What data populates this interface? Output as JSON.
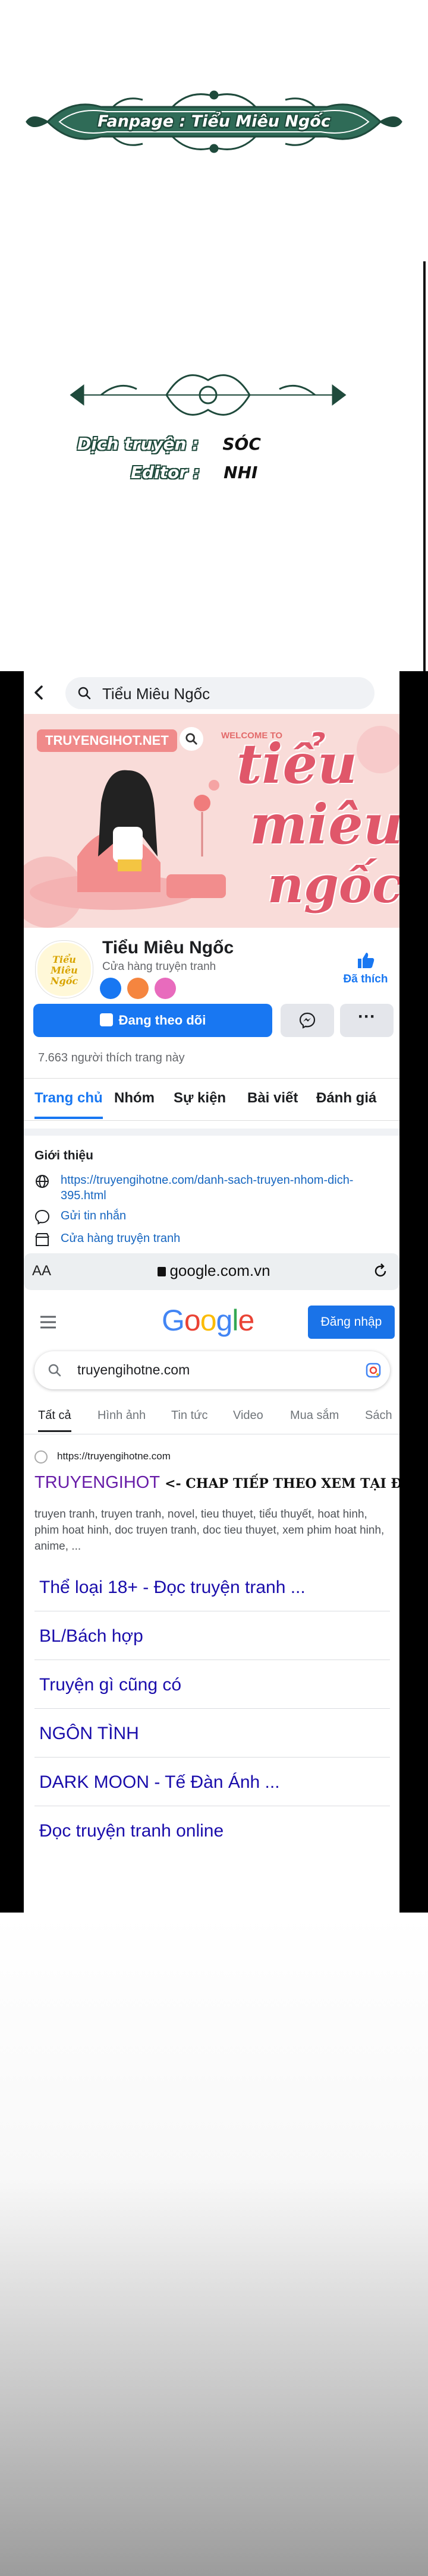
{
  "credits": {
    "fanpage": "Fanpage : Tiểu Miêu Ngốc",
    "translator_label": "Dịch truyện :",
    "translator": "SÓC",
    "editor_label": "Editor :",
    "editor": "NHI"
  },
  "facebook": {
    "search_text": "Tiểu Miêu Ngốc",
    "cover": {
      "logo": "TRUYENGIHOT.NET",
      "welcome": "WELCOME TO",
      "script_lines": [
        "tiểu",
        "miêu",
        "ngốc"
      ]
    },
    "page_name": "Tiểu Miêu Ngốc",
    "category": "Cửa hàng truyện tranh",
    "followed_label": "Đã thích",
    "follow_button": "Đang theo dõi",
    "more_button": "···",
    "likes_text": "7.663 người thích trang này",
    "tabs": [
      "Trang chủ",
      "Nhóm",
      "Sự kiện",
      "Bài viết",
      "Đánh giá"
    ],
    "about": {
      "title": "Giới thiệu",
      "website": "https://truyengihotne.com/danh-sach-truyen-nhom-dich-395.html",
      "message": "Gửi tin nhắn",
      "category": "Cửa hàng truyện tranh"
    },
    "avatar_text": "Tiểu Miêu Ngốc"
  },
  "browser": {
    "aa": "AA",
    "url": "google.com.vn"
  },
  "google": {
    "logo_letters": [
      "G",
      "o",
      "o",
      "g",
      "l",
      "e"
    ],
    "logo_colors": [
      "#4285f4",
      "#ea4335",
      "#fbbc05",
      "#4285f4",
      "#34a853",
      "#ea4335"
    ],
    "signin": "Đăng nhập",
    "query": "truyengihotne.com",
    "tabs": [
      "Tất cả",
      "Hình ảnh",
      "Tin tức",
      "Video",
      "Mua sắm",
      "Sách"
    ],
    "result": {
      "url": "https://truyengihotne.com",
      "title": "TRUYENGIHOT",
      "title_note": "<- CHAP TIẾP THEO XEM TẠI ĐÂY NHA",
      "description": "truyen tranh, truyen tranh, novel, tieu thuyet, tiểu thuyết, hoat hinh, phim hoat hinh, doc truyen tranh, doc tieu thuyet, xem phim hoat hinh, anime, ..."
    },
    "sitelinks": [
      "Thể loại 18+ - Đọc truyện tranh ...",
      "BL/Bách hợp",
      "Truyện gì cũng có",
      "NGÔN TÌNH",
      "DARK MOON - Tế Đàn Ánh ...",
      "Đọc truyện tranh online"
    ]
  },
  "colors": {
    "facebook_blue": "#1877f2",
    "banner_green": "#1f4a3c",
    "cover_pink": "#f9d9d6",
    "link_blue": "#1a0dab",
    "visited_purple": "#681da8"
  }
}
